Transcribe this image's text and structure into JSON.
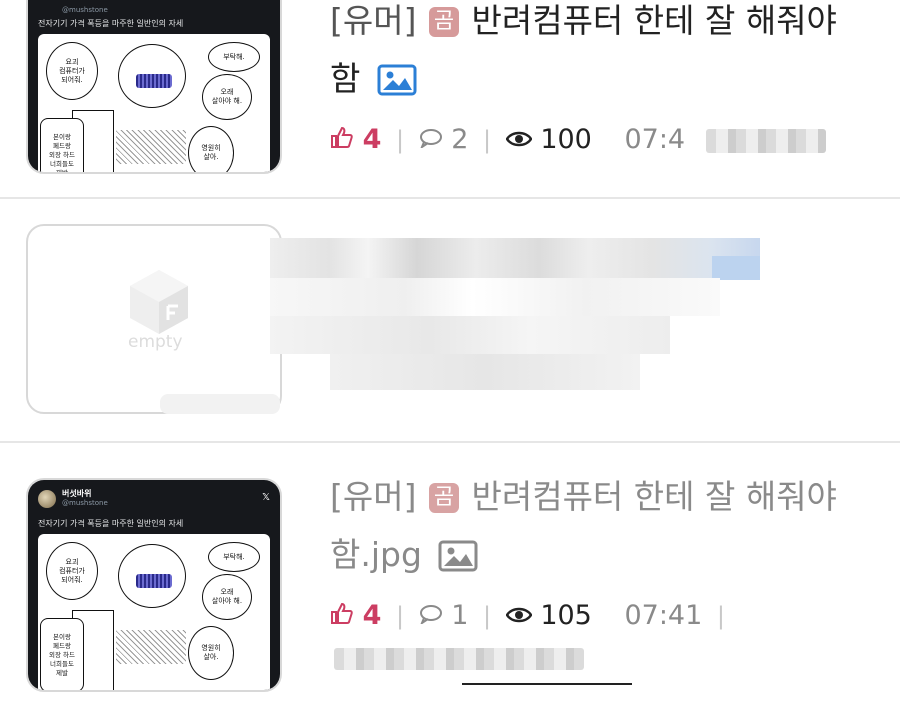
{
  "posts": [
    {
      "tweet": {
        "handle": "@mushstone",
        "text": "전자기기 가격 폭등을 마주한 일반인의 자세",
        "bubbles": [
          "요괴\n컴퓨터가\n되어줘.",
          "부탁해.",
          "오래\n살아야 해.",
          "영원히\n살아.",
          "본이랑\n페드랑\n외장 하드\n너희들도\n제발"
        ]
      },
      "title_tag": "[유머]",
      "category_badge": "곰",
      "title_line1": "반려컴퓨터 한테 잘 해줘야",
      "title_line2": "함",
      "likes": "4",
      "comments": "2",
      "views": "100",
      "time": "07:4"
    },
    {
      "thumbnail_placeholder": "empty",
      "state": "blurred"
    },
    {
      "tweet": {
        "name": "버섯바위",
        "handle": "@mushstone",
        "close_glyph": "𝕏",
        "text": "전자기기 가격 폭등을 마주한 일반인의 자세",
        "bubbles": [
          "요괴\n컴퓨터가\n되어줘.",
          "부탁해.",
          "오래\n살아야 해.",
          "영원히\n살아.",
          "본이랑\n페드랑\n외장 하드\n너희들도\n제발"
        ]
      },
      "title_tag": "[유머]",
      "category_badge": "곰",
      "title_line1": "반려컴퓨터 한테 잘 해줘야",
      "title_line2": "함.jpg",
      "likes": "4",
      "comments": "1",
      "views": "105",
      "time": "07:41"
    }
  ],
  "colors": {
    "like": "#cc3d62",
    "badge": "#d69a9a",
    "image_icon_blue": "#2b7fd6",
    "divider": "#e6e6e6"
  },
  "icons": [
    "thumbs-up-icon",
    "comment-icon",
    "eye-icon",
    "image-icon",
    "empty-box-icon"
  ]
}
